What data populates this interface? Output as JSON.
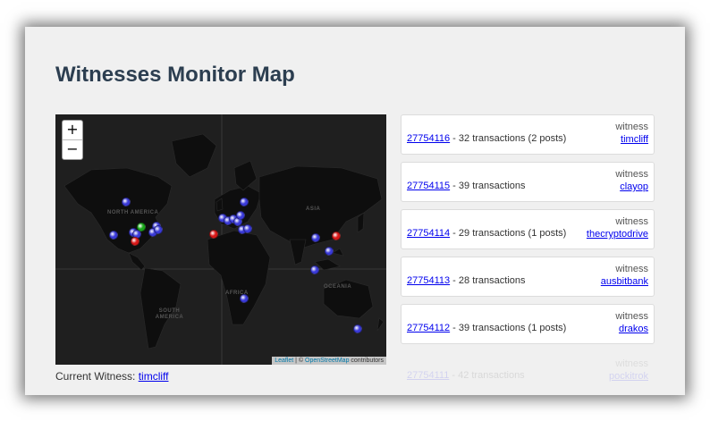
{
  "page": {
    "title": "Witnesses Monitor Map"
  },
  "map": {
    "zoom_in": "+",
    "zoom_out": "−",
    "labels": {
      "north_america": "NORTH AMERICA",
      "asia": "ASIA",
      "africa": "AFRICA",
      "south_america": "SOUTH AMERICA",
      "oceania": "OCEANIA"
    },
    "attribution": {
      "leaflet": "Leaflet",
      "sep": " | © ",
      "osm": "OpenStreetMap",
      "suffix": " contributors"
    },
    "marker_colors": {
      "blue": "#3a3ad8",
      "red": "#d81818",
      "green": "#1aa81a"
    }
  },
  "current_witness": {
    "label": "Current Witness: ",
    "name": "timcliff"
  },
  "blocks": [
    {
      "block": "27754116",
      "text": " - 32 transactions (2 posts)",
      "witness_label": "witness",
      "witness": "timcliff"
    },
    {
      "block": "27754115",
      "text": " - 39 transactions",
      "witness_label": "witness",
      "witness": "clayop"
    },
    {
      "block": "27754114",
      "text": " - 29 transactions (1 posts)",
      "witness_label": "witness",
      "witness": "thecryptodrive"
    },
    {
      "block": "27754113",
      "text": " - 28 transactions",
      "witness_label": "witness",
      "witness": "ausbitbank"
    },
    {
      "block": "27754112",
      "text": " - 39 transactions (1 posts)",
      "witness_label": "witness",
      "witness": "drakos"
    },
    {
      "block": "27754111",
      "text": " - 42 transactions",
      "witness_label": "witness",
      "witness": "pockitrok"
    }
  ]
}
